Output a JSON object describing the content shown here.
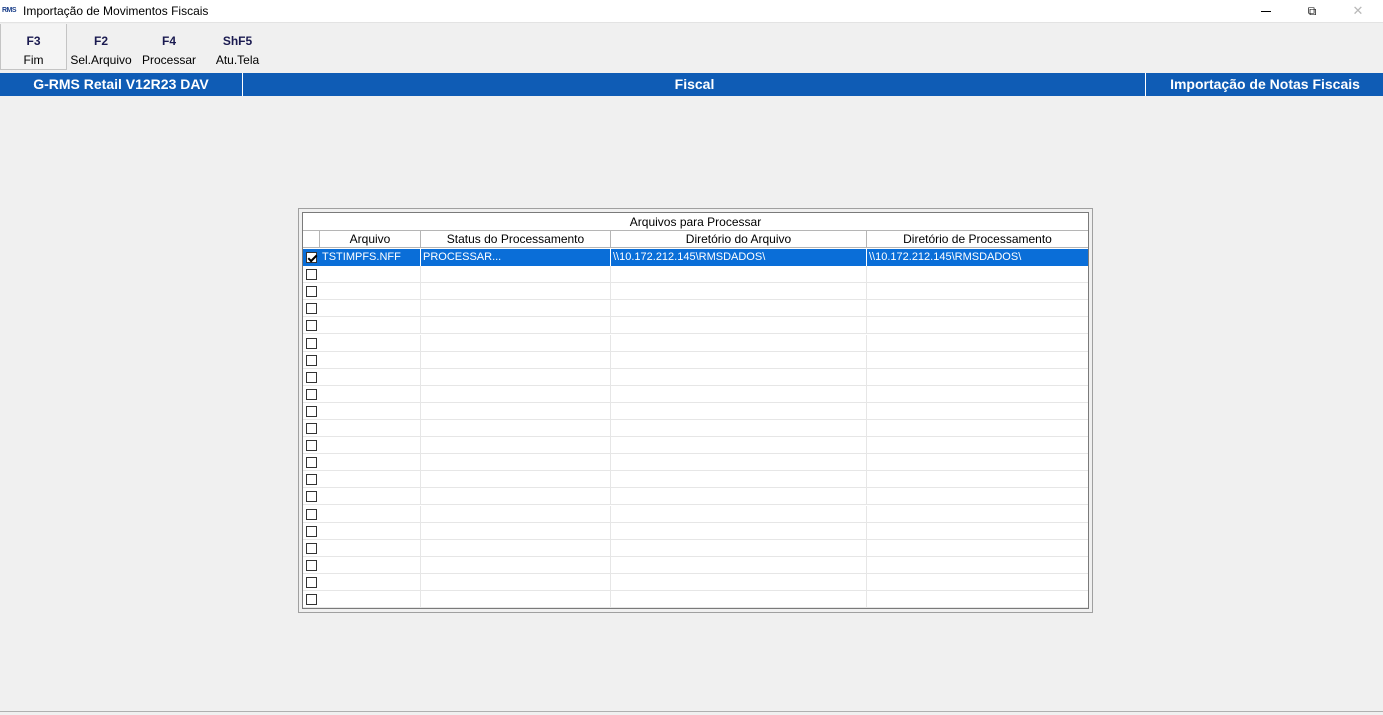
{
  "window": {
    "title": "Importação de Movimentos Fiscais",
    "icon_text": "RMS",
    "close_glyph": "✕",
    "restore_glyph": "⧉"
  },
  "toolbar": [
    {
      "key": "F3",
      "label": "Fim"
    },
    {
      "key": "F2",
      "label": "Sel.Arquivo"
    },
    {
      "key": "F4",
      "label": "Processar"
    },
    {
      "key": "ShF5",
      "label": "Atu.Tela"
    }
  ],
  "header": {
    "version": "G-RMS Retail V12R23 DAV",
    "module": "Fiscal",
    "screen": "Importação de Notas Fiscais",
    "color": "#0f5cb5"
  },
  "grid": {
    "caption": "Arquivos para Processar",
    "columns": [
      "Arquivo",
      "Status do Processamento",
      "Diretório do Arquivo",
      "Diretório de Processamento"
    ],
    "rows": [
      {
        "checked": true,
        "arquivo": "TSTIMPFS.NFF",
        "status": "PROCESSAR...",
        "diretorio": "\\\\10.172.212.145\\RMSDADOS\\",
        "processamento": "\\\\10.172.212.145\\RMSDADOS\\",
        "selected": true
      }
    ],
    "empty_rows": 20,
    "selection_color": "#0a6ed8"
  }
}
